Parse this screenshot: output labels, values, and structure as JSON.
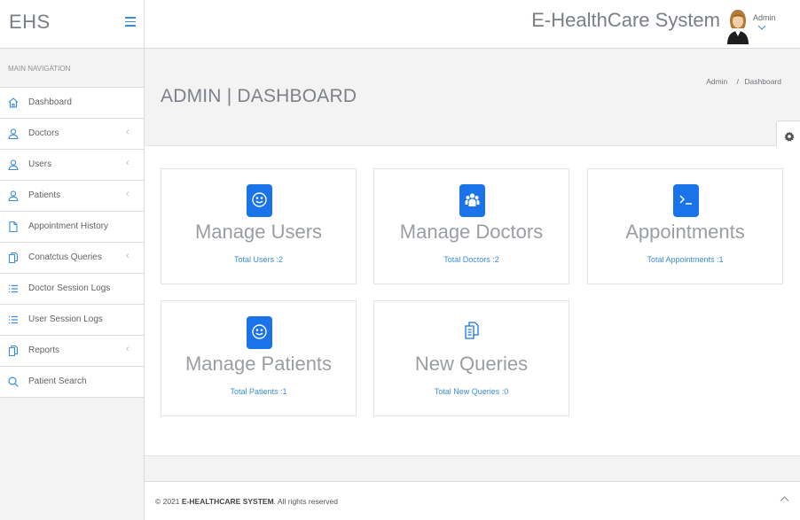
{
  "brand": {
    "short": "EHS"
  },
  "header": {
    "app_title": "E-HealthCare System",
    "user_name": "Admin"
  },
  "sidebar": {
    "section_label": "MAIN NAVIGATION",
    "items": [
      {
        "label": "Dashboard",
        "icon": "home-icon",
        "has_chevron": false
      },
      {
        "label": "Doctors",
        "icon": "user-icon",
        "has_chevron": true
      },
      {
        "label": "Users",
        "icon": "user-icon",
        "has_chevron": true
      },
      {
        "label": "Patients",
        "icon": "user-icon",
        "has_chevron": true
      },
      {
        "label": "Appointment History",
        "icon": "file-icon",
        "has_chevron": false
      },
      {
        "label": "Conatctus Queries",
        "icon": "files-icon",
        "has_chevron": true
      },
      {
        "label": "Doctor Session Logs",
        "icon": "list-icon",
        "has_chevron": false
      },
      {
        "label": "User Session Logs",
        "icon": "list-icon",
        "has_chevron": false
      },
      {
        "label": "Reports",
        "icon": "files-icon",
        "has_chevron": true
      },
      {
        "label": "Patient Search",
        "icon": "search-icon",
        "has_chevron": false
      }
    ]
  },
  "page": {
    "title": "ADMIN | DASHBOARD",
    "breadcrumb": {
      "parent": "Admin",
      "separator": "/",
      "current": "Dashboard"
    }
  },
  "cards": [
    {
      "title": "Manage Users",
      "stat": "Total Users :2",
      "icon": "smile-icon"
    },
    {
      "title": "Manage Doctors",
      "stat": "Total Doctors :2",
      "icon": "users-icon"
    },
    {
      "title": "Appointments",
      "stat": "Total Appointments :1",
      "icon": "terminal-icon"
    },
    {
      "title": "Manage Patients",
      "stat": "Total Patients :1",
      "icon": "smile-icon"
    },
    {
      "title": "New Queries",
      "stat": "Total New Queries :0",
      "icon": "files-icon"
    }
  ],
  "footer": {
    "year": "© 2021",
    "brand": "E-HEALTHCARE SYSTEM",
    "suffix": ". All rights reserved"
  },
  "colors": {
    "accent": "#1a73e8",
    "link": "#3a8dde",
    "muted_text": "#9a9ea3"
  }
}
